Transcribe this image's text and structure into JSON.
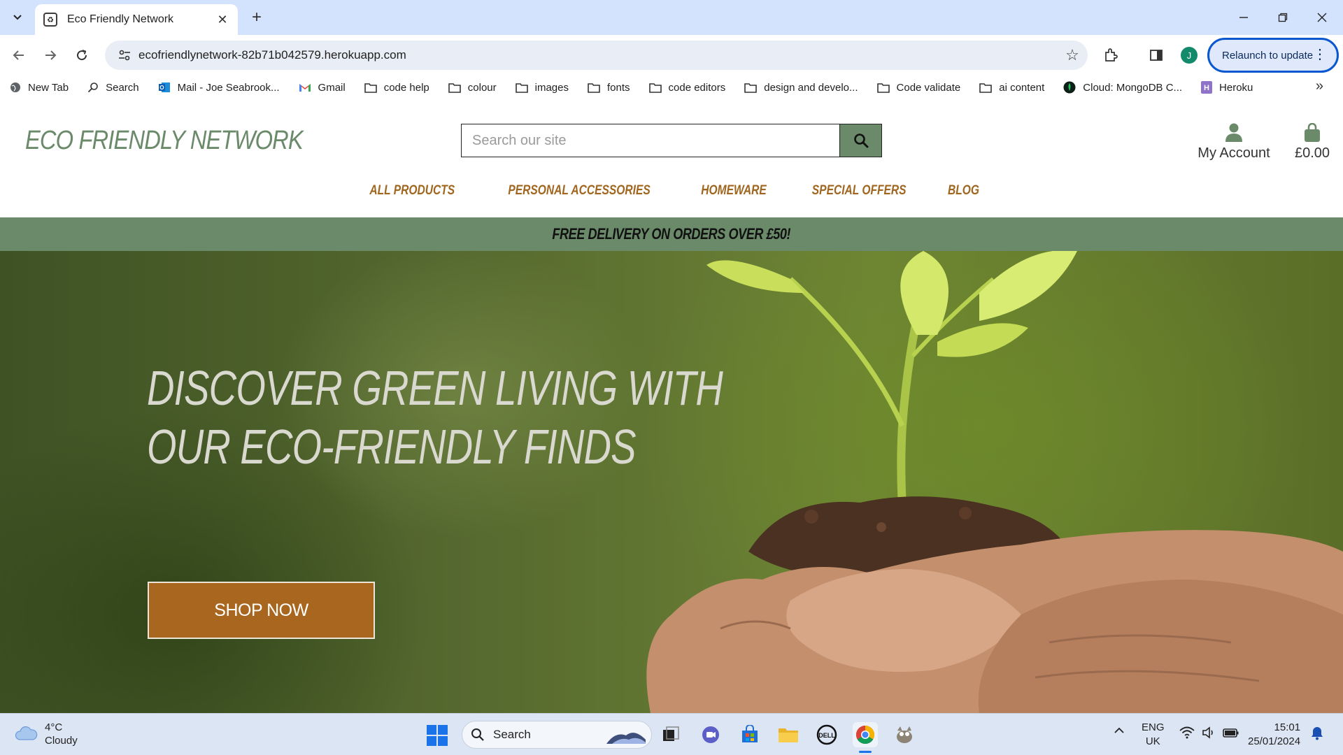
{
  "browser": {
    "tab_title": "Eco Friendly Network",
    "url": "ecofriendlynetwork-82b71b042579.herokuapp.com",
    "profile_initial": "J",
    "relaunch_label": "Relaunch to update",
    "bookmarks": [
      {
        "label": "New Tab",
        "icon": "globe-icon"
      },
      {
        "label": "Search",
        "icon": "search-icon"
      },
      {
        "label": "Mail - Joe Seabrook...",
        "icon": "outlook-icon"
      },
      {
        "label": "Gmail",
        "icon": "gmail-icon"
      },
      {
        "label": "code help",
        "icon": "folder-icon"
      },
      {
        "label": "colour",
        "icon": "folder-icon"
      },
      {
        "label": "images",
        "icon": "folder-icon"
      },
      {
        "label": "fonts",
        "icon": "folder-icon"
      },
      {
        "label": "code editors",
        "icon": "folder-icon"
      },
      {
        "label": "design and develo...",
        "icon": "folder-icon"
      },
      {
        "label": "Code validate",
        "icon": "folder-icon"
      },
      {
        "label": "ai content",
        "icon": "folder-icon"
      },
      {
        "label": "Cloud: MongoDB C...",
        "icon": "mongodb-icon"
      },
      {
        "label": "Heroku",
        "icon": "heroku-icon"
      }
    ]
  },
  "site": {
    "logo_text": "ECO FRIENDLY NETWORK",
    "search_placeholder": "Search our site",
    "account_label": "My Account",
    "cart_total": "£0.00",
    "nav": [
      "ALL PRODUCTS",
      "PERSONAL ACCESSORIES",
      "HOMEWARE",
      "SPECIAL OFFERS",
      "BLOG"
    ],
    "banner_text": "FREE DELIVERY ON ORDERS OVER £50!",
    "hero": {
      "heading_line1": "DISCOVER GREEN LIVING WITH",
      "heading_line2": "OUR ECO-FRIENDLY FINDS",
      "button_label": "SHOP NOW"
    },
    "colors": {
      "brand_green": "#6a8a6a",
      "nav_brown": "#a0661f",
      "button_brown": "#a8661e"
    }
  },
  "taskbar": {
    "weather_temp": "4°C",
    "weather_desc": "Cloudy",
    "search_label": "Search",
    "lang_line1": "ENG",
    "lang_line2": "UK",
    "time": "15:01",
    "date": "25/01/2024"
  }
}
